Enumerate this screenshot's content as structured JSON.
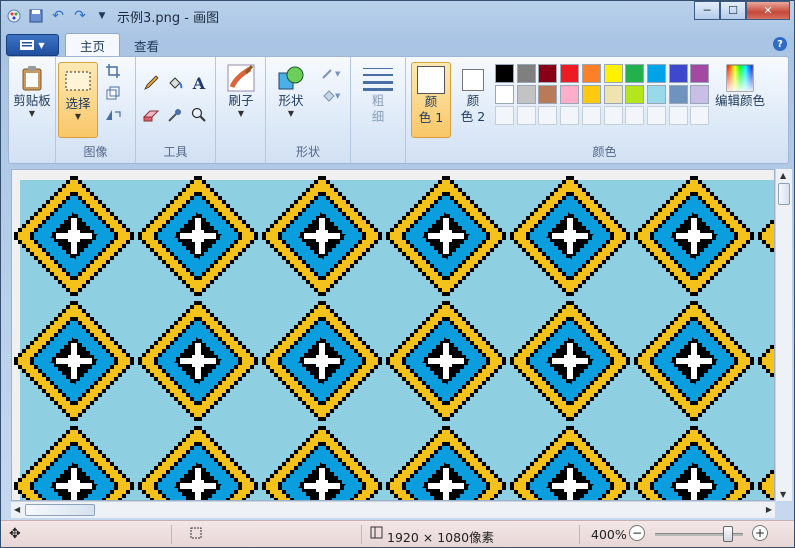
{
  "window": {
    "title": "示例3.png - 画图",
    "minimize": "─",
    "maximize": "☐",
    "close": "✕"
  },
  "tabs": [
    {
      "label": "主页"
    },
    {
      "label": "查看"
    }
  ],
  "help": "?",
  "ribbon": {
    "clipboard": {
      "label": "剪贴板"
    },
    "image": {
      "group_label": "图像",
      "select_label": "选择"
    },
    "tools": {
      "group_label": "工具"
    },
    "brush": {
      "label": "刷子"
    },
    "shapes": {
      "label": "形状",
      "group_label": "形状"
    },
    "size": {
      "label": "粗\n细"
    },
    "color1": {
      "label": "颜\n色 1"
    },
    "color2": {
      "label": "颜\n色 2"
    },
    "colors": {
      "group_label": "颜色",
      "edit_label": "编辑颜色",
      "row1": [
        "#000000",
        "#7f7f7f",
        "#880015",
        "#ed1c24",
        "#ff7f27",
        "#fff200",
        "#22b14c",
        "#00a2e8",
        "#3f48cc",
        "#a349a4"
      ],
      "row2": [
        "#ffffff",
        "#c3c3c3",
        "#b97a57",
        "#ffaec9",
        "#ffc90e",
        "#efe4b0",
        "#b5e61d",
        "#99d9ea",
        "#7092be",
        "#c8bfe7"
      ]
    }
  },
  "status": {
    "dimensions": "1920 × 1080像素",
    "zoom": "400%",
    "zoom_level_percent": 400
  },
  "canvas_colors": {
    "background": "#8ecfe1",
    "diamond_blue": "#0a9ede",
    "border_yellow": "#f5c21b",
    "edge_black": "#000000"
  }
}
